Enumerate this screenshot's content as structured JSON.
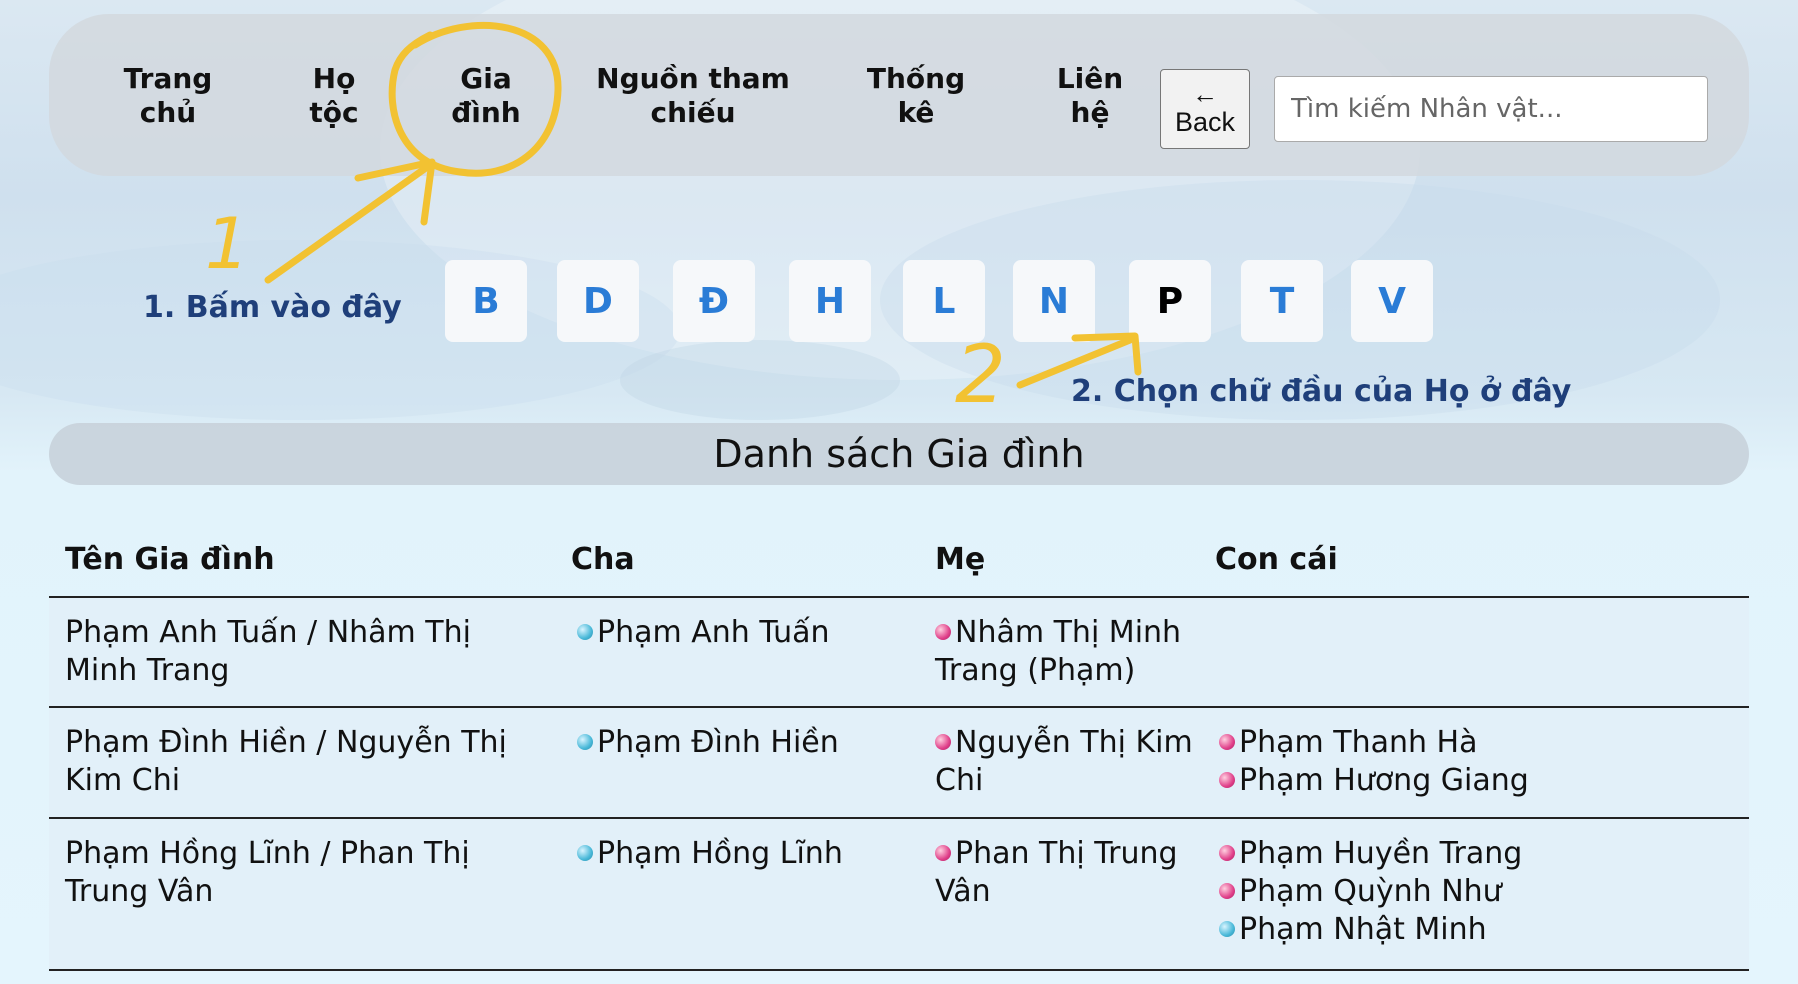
{
  "nav": {
    "items": [
      {
        "line1": "Trang",
        "line2": "chủ"
      },
      {
        "line1": "Họ",
        "line2": "tộc"
      },
      {
        "line1": "Gia",
        "line2": "đình"
      },
      {
        "line1": "Nguồn tham",
        "line2": "chiếu"
      },
      {
        "line1": "Thống",
        "line2": "kê"
      },
      {
        "line1": "Liên",
        "line2": "hệ"
      }
    ],
    "back_label": "Back",
    "search_placeholder": "Tìm kiếm Nhân vật..."
  },
  "letters": [
    "B",
    "D",
    "Đ",
    "H",
    "L",
    "N",
    "P",
    "T",
    "V"
  ],
  "active_letter": "P",
  "annotations": {
    "step1": "1. Bấm vào đây",
    "step2": "2. Chọn chữ đầu của Họ ở đây",
    "mark1": "1",
    "mark2": "2",
    "mark_color": "#f2c232"
  },
  "list_title": "Danh sách Gia đình",
  "table": {
    "headers": [
      "Tên Gia đình",
      "Cha",
      "Mẹ",
      "Con cái"
    ],
    "rows": [
      {
        "family": "Phạm Anh Tuấn / Nhâm Thị Minh Trang",
        "father": "Phạm Anh Tuấn",
        "mother": "Nhâm Thị Minh Trang (Phạm)",
        "children": []
      },
      {
        "family": "Phạm Đình Hiền / Nguyễn Thị Kim Chi",
        "father": "Phạm Đình Hiền",
        "mother": "Nguyễn Thị Kim Chi",
        "children": [
          {
            "name": "Phạm Thanh Hà",
            "gender": "f"
          },
          {
            "name": "Phạm Hương Giang",
            "gender": "f"
          }
        ]
      },
      {
        "family": "Phạm Hồng Lĩnh / Phan Thị Trung Vân",
        "father": "Phạm Hồng Lĩnh",
        "mother": "Phan Thị Trung Vân",
        "children": [
          {
            "name": "Phạm Huyền Trang",
            "gender": "f"
          },
          {
            "name": "Phạm Quỳnh Như",
            "gender": "f"
          },
          {
            "name": "Phạm Nhật Minh",
            "gender": "m"
          }
        ]
      }
    ]
  }
}
